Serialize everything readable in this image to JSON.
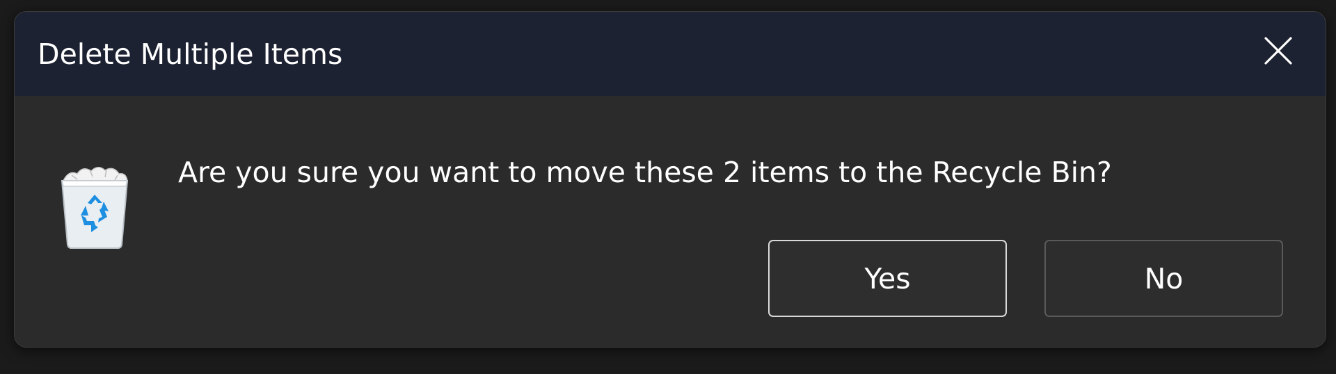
{
  "dialog": {
    "title": "Delete Multiple Items",
    "message": "Are you sure you want to move these 2 items to the Recycle Bin?",
    "icon": "recycle-bin-icon",
    "close_icon": "close-icon",
    "buttons": {
      "yes_label": "Yes",
      "no_label": "No"
    }
  },
  "colors": {
    "titlebar_bg": "#1c2231",
    "dialog_bg": "#2b2b2b",
    "text": "#ffffff",
    "recycle_blue": "#1e8fe0"
  }
}
